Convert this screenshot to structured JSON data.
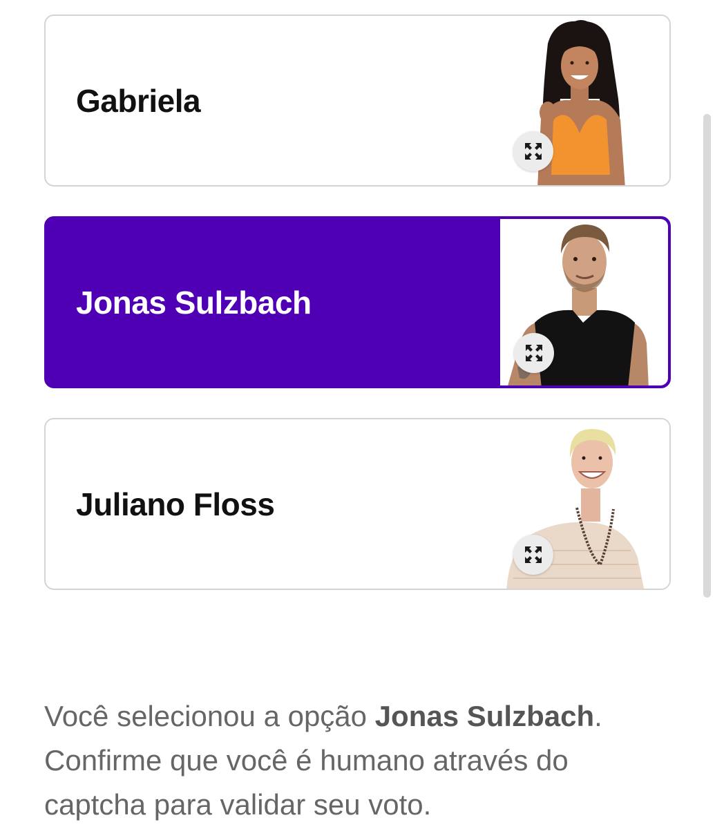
{
  "options": [
    {
      "name": "Gabriela",
      "selected": false
    },
    {
      "name": "Jonas Sulzbach",
      "selected": true
    },
    {
      "name": "Juliano Floss",
      "selected": false
    }
  ],
  "confirmation": {
    "prefix": "Você selecionou a opção ",
    "selected_name": "Jonas Sulzbach",
    "suffix": ".",
    "line2": "Confirme que você é humano através do captcha para validar seu voto."
  },
  "icons": {
    "expand": "expand-arrows-icon"
  },
  "colors": {
    "selected_bg": "#4f00b5",
    "border": "#d4d4d4",
    "text": "#111111",
    "muted_text": "#666666"
  }
}
